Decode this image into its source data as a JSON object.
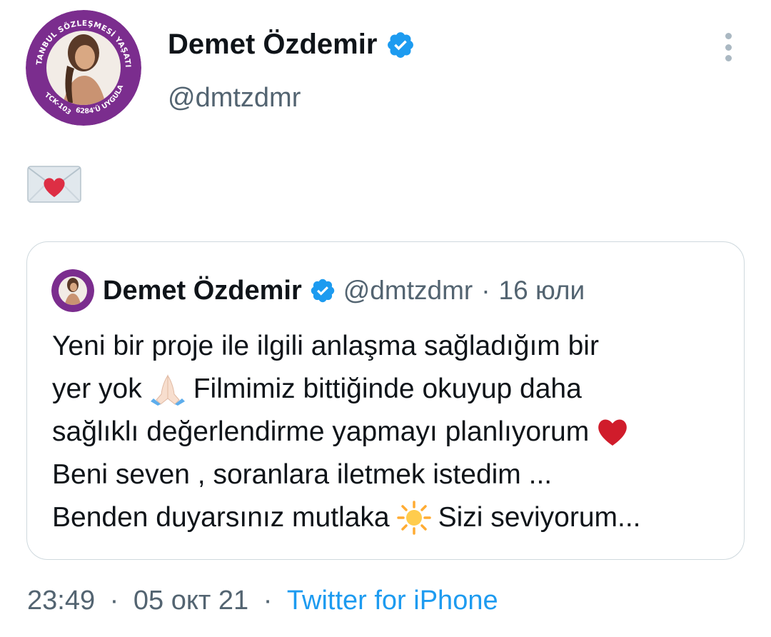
{
  "author": {
    "name": "Demet Özdemir",
    "handle": "@dmtzdmr",
    "avatar_ring": {
      "top_text": "İSTANBUL SÖZLEŞMESİ YAŞATIR",
      "left_text": "TCK-103",
      "bottom_text": "6284'Ü UYGULA",
      "ring_color": "#7b2d8e"
    }
  },
  "tweet": {
    "emoji": "love-letter-emoji"
  },
  "quote": {
    "name": "Demet Özdemir",
    "handle": "@dmtzdmr",
    "separator": "·",
    "date": "16 юли",
    "lines": [
      {
        "text": "Yeni bir proje ile ilgili anlaşma sağladığım bir"
      },
      {
        "before": "yer yok",
        "emoji": "folded-hands-emoji",
        "after": "Filmimiz bittiğinde okuyup daha"
      },
      {
        "before": "sağlıklı değerlendirme yapmayı planlıyorum",
        "emoji": "red-heart-emoji"
      },
      {
        "text": "Beni seven , soranlara iletmek istedim ..."
      },
      {
        "before": "Benden duyarsınız mutlaka",
        "emoji": "sun-emoji",
        "after": "Sizi seviyorum..."
      }
    ]
  },
  "footer": {
    "time": "23:49",
    "separator1": "·",
    "date": "05 окт 21",
    "separator2": "·",
    "source": "Twitter for iPhone"
  },
  "colors": {
    "text": "#0f1419",
    "secondary": "#536471",
    "link": "#1d9bf0",
    "verified": "#1d9bf0",
    "border": "#cfd9de",
    "heart": "#d01c2b"
  }
}
